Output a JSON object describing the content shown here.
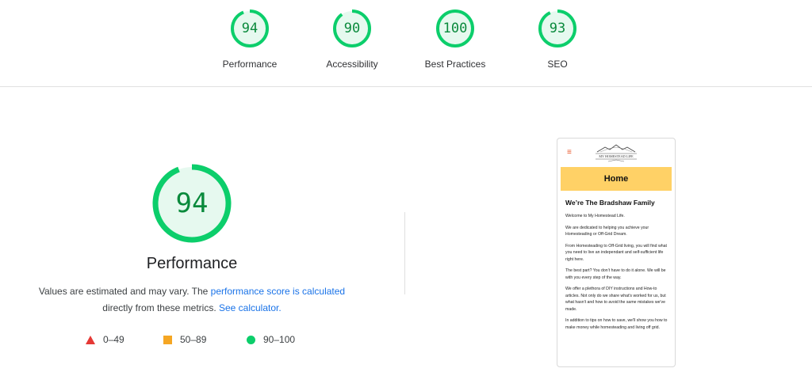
{
  "categories": [
    {
      "score": "94",
      "label": "Performance"
    },
    {
      "score": "90",
      "label": "Accessibility"
    },
    {
      "score": "100",
      "label": "Best Practices"
    },
    {
      "score": "93",
      "label": "SEO"
    }
  ],
  "colors": {
    "pass": "#0cce6b",
    "pass_text": "#0a8a3c",
    "pass_fill": "#e6f9ef",
    "average": "#f5a623",
    "fail": "#e53935",
    "link": "#1a73e8"
  },
  "main": {
    "score": "94",
    "title": "Performance",
    "desc_part1": "Values are estimated and may vary. The ",
    "desc_link1": "performance score is calculated",
    "desc_part2": "directly from these metrics. ",
    "desc_link2": "See calculator."
  },
  "legend": [
    {
      "icon": "triangle-icon",
      "range": "0–49"
    },
    {
      "icon": "square-icon",
      "range": "50–89"
    },
    {
      "icon": "circle-icon",
      "range": "90–100"
    }
  ],
  "screenshot": {
    "menu_icon": "≡",
    "logo_text": "MY HOMESTEAD LIFE",
    "banner": "Home",
    "heading": "We’re The Bradshaw Family",
    "paragraphs": [
      "Welcome to My Homestead Life.",
      "We are dedicated to helping you achieve your Homesteading or Off-Grid Dream.",
      "From Homesteading to Off-Grid living, you will find what you need to live an independant and self-sufficient life right here.",
      "The best part? You don’t have to do it alone. We will be with you every step of the way.",
      "We offer a plethora of DIY instructions and How-to articles. Not only do we share what's worked for us, but what hasn't and how to avoid the same mistakes we've made.",
      "In addition to tips on how to save, we'll show you how to make money while homesteading and living off grid."
    ]
  }
}
